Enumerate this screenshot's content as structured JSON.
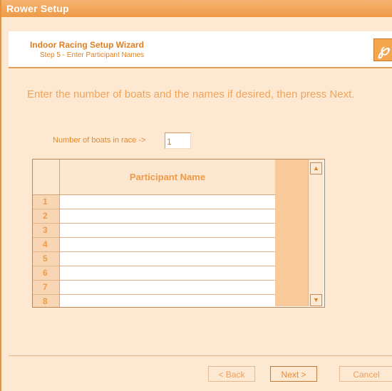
{
  "window": {
    "title": "Rower Setup"
  },
  "header": {
    "title": "Indoor Racing Setup Wizard",
    "subtitle": "Step 5 - Enter Participant Names",
    "logo_icon": "rower-logo-icon"
  },
  "instruction": "Enter the number of boats and the names if desired, then press Next.",
  "boats": {
    "label": "Number of boats in race ->",
    "value": "1"
  },
  "grid": {
    "column_header": "Participant Name",
    "rows": [
      {
        "num": "1",
        "name": ""
      },
      {
        "num": "2",
        "name": ""
      },
      {
        "num": "3",
        "name": ""
      },
      {
        "num": "4",
        "name": ""
      },
      {
        "num": "5",
        "name": ""
      },
      {
        "num": "6",
        "name": ""
      },
      {
        "num": "7",
        "name": ""
      },
      {
        "num": "8",
        "name": ""
      }
    ]
  },
  "buttons": {
    "back": "< Back",
    "next": "Next >",
    "cancel": "Cancel"
  },
  "colors": {
    "accent": "#ee9a48",
    "background": "#fde8d2"
  }
}
